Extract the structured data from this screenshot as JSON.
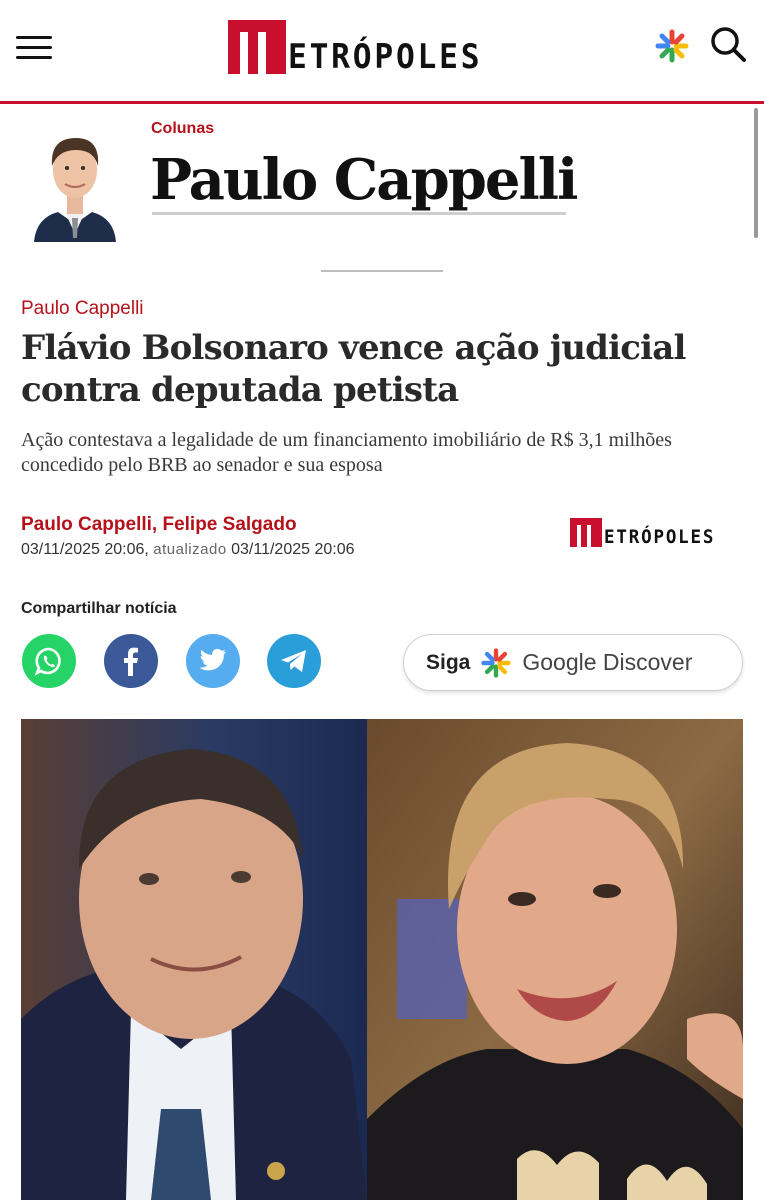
{
  "header": {
    "logo_text": "ETRÓPOLES",
    "menu_icon": "hamburger-menu-icon",
    "google_icon": "google-star-icon",
    "search_icon": "search-icon"
  },
  "column": {
    "section_label": "Colunas",
    "title": "Paulo Cappelli"
  },
  "article": {
    "kicker": "Paulo Cappelli",
    "headline": "Flávio Bolsonaro vence ação judicial contra deputada petista",
    "subtitle": "Ação contestava a legalidade de um financiamento imobiliário de R$ 3,1 milhões concedido pelo BRB ao senador e sua esposa",
    "byline": "Paulo Cappelli, Felipe Salgado",
    "published": "03/11/2025 20:06,",
    "updated_label": "atualizado",
    "updated": "03/11/2025 20:06",
    "source_logo_text": "ETRÓPOLES"
  },
  "share": {
    "label": "Compartilhar notícia",
    "buttons": [
      "whatsapp-icon",
      "facebook-icon",
      "twitter-icon",
      "telegram-icon"
    ],
    "discover_siga": "Siga",
    "discover_text": "Google Discover"
  },
  "colors": {
    "brand_red": "#c8102e",
    "whatsapp": "#25d366",
    "facebook": "#3b5998",
    "twitter": "#55acee",
    "telegram": "#2a9ed8"
  }
}
